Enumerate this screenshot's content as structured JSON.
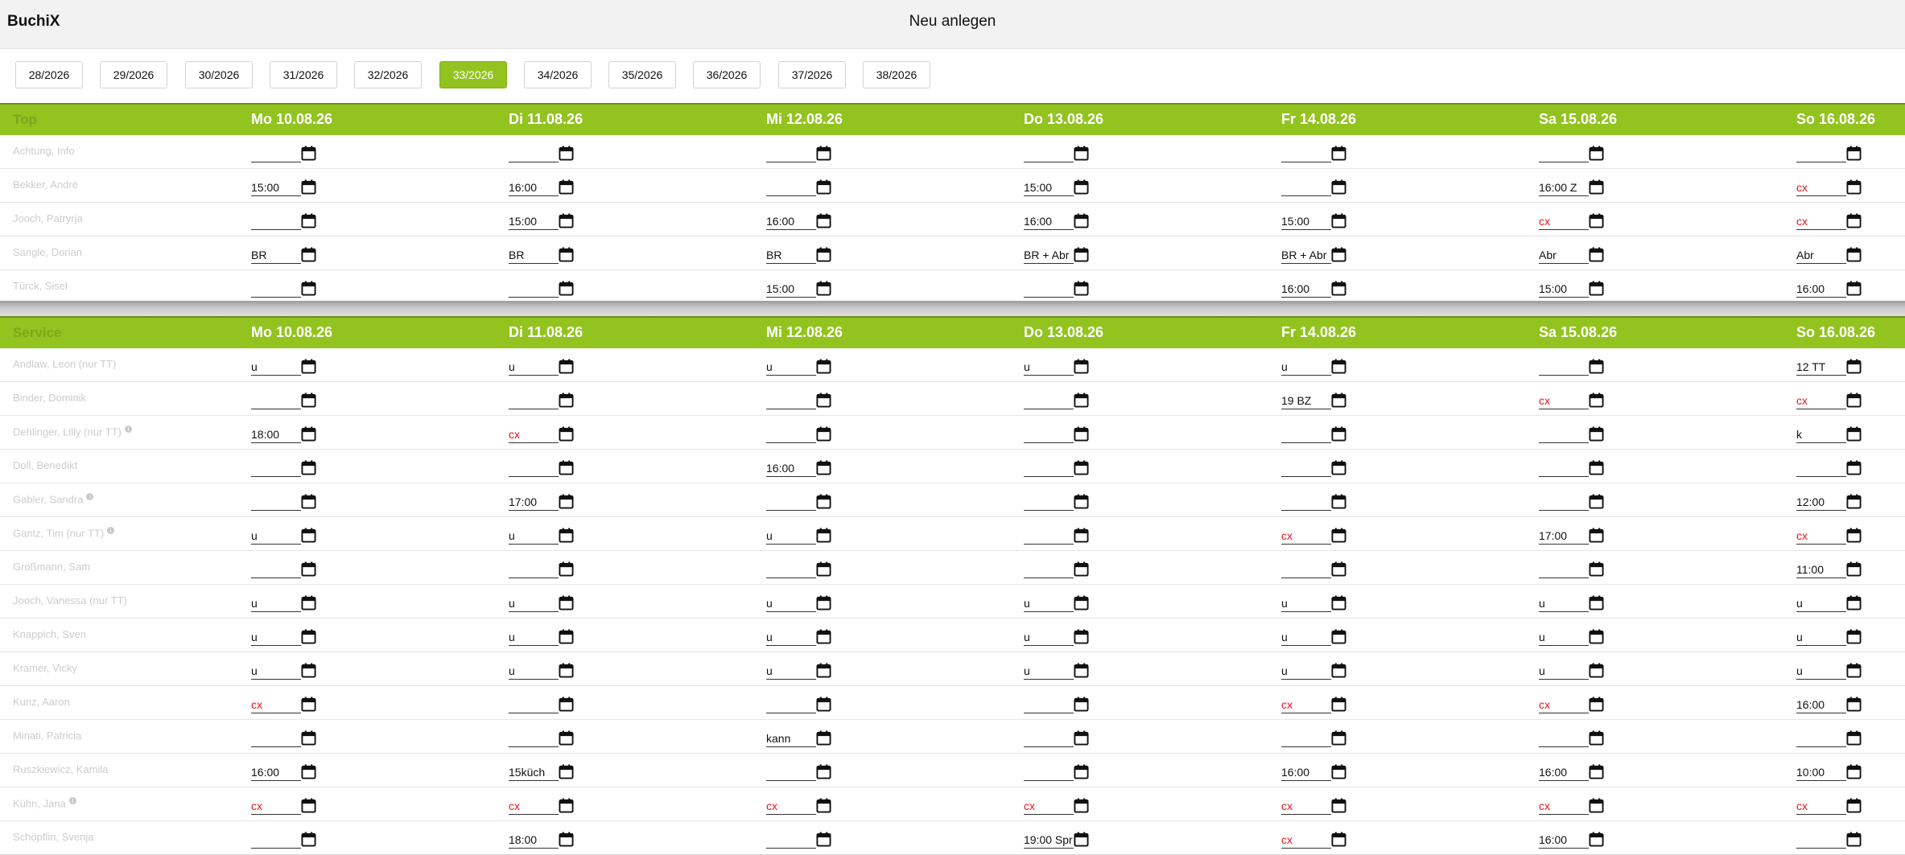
{
  "app": {
    "title": "BuchiX",
    "action": "Neu anlegen"
  },
  "weeks": [
    {
      "label": "28/2026",
      "active": false
    },
    {
      "label": "29/2026",
      "active": false
    },
    {
      "label": "30/2026",
      "active": false
    },
    {
      "label": "31/2026",
      "active": false
    },
    {
      "label": "32/2026",
      "active": false
    },
    {
      "label": "33/2026",
      "active": true
    },
    {
      "label": "34/2026",
      "active": false
    },
    {
      "label": "35/2026",
      "active": false
    },
    {
      "label": "36/2026",
      "active": false
    },
    {
      "label": "37/2026",
      "active": false
    },
    {
      "label": "38/2026",
      "active": false
    }
  ],
  "days": [
    "Mo 10.08.26",
    "Di 11.08.26",
    "Mi 12.08.26",
    "Do 13.08.26",
    "Fr 14.08.26",
    "Sa 15.08.26",
    "So 16.08.26"
  ],
  "colors": {
    "accent": "#92c31f",
    "cancel_text": "#e8141c",
    "name_text": "#cdcdcd"
  },
  "sections": [
    {
      "name": "Top",
      "rows": [
        {
          "name": "Achtung, Info",
          "info": false,
          "cells": [
            "",
            "",
            "",
            "",
            "",
            "",
            ""
          ]
        },
        {
          "name": "Bekker, André",
          "info": false,
          "cells": [
            "15:00",
            "16:00",
            "",
            "15:00",
            "",
            "16:00 Z",
            "cx"
          ]
        },
        {
          "name": "Jooch, Patryrja",
          "info": false,
          "cells": [
            "",
            "15:00",
            "16:00",
            "16:00",
            "15:00",
            "cx",
            "cx"
          ]
        },
        {
          "name": "Sangle, Dorian",
          "info": false,
          "cells": [
            "BR",
            "BR",
            "BR",
            "BR + Abr",
            "BR + Abr",
            "Abr",
            "Abr"
          ]
        },
        {
          "name": "Türck, Sisel",
          "info": false,
          "cells": [
            "",
            "",
            "15:00",
            "",
            "16:00",
            "15:00",
            "16:00"
          ]
        }
      ]
    },
    {
      "name": "Service",
      "rows": [
        {
          "name": "Andlaw, Leon (nur TT)",
          "info": false,
          "cells": [
            "u",
            "u",
            "u",
            "u",
            "u",
            "",
            "12 TT"
          ]
        },
        {
          "name": "Binder, Dominik",
          "info": false,
          "cells": [
            "",
            "",
            "",
            "",
            "19 BZ",
            "cx",
            "cx"
          ]
        },
        {
          "name": "Dehlinger, Lilly (nur TT)",
          "info": true,
          "cells": [
            "18:00",
            "cx",
            "",
            "",
            "",
            "",
            "k"
          ]
        },
        {
          "name": "Doll, Benedikt",
          "info": false,
          "cells": [
            "",
            "",
            "16:00",
            "",
            "",
            "",
            ""
          ]
        },
        {
          "name": "Gabler, Sandra",
          "info": true,
          "cells": [
            "",
            "17:00",
            "",
            "",
            "",
            "",
            "12:00"
          ]
        },
        {
          "name": "Gantz, Tim (nur TT)",
          "info": true,
          "cells": [
            "u",
            "u",
            "u",
            "",
            "cx",
            "17:00",
            "cx"
          ]
        },
        {
          "name": "Großmann, Sam",
          "info": false,
          "cells": [
            "",
            "",
            "",
            "",
            "",
            "",
            "11:00"
          ]
        },
        {
          "name": "Jooch, Vanessa (nur TT)",
          "info": false,
          "cells": [
            "u",
            "u",
            "u",
            "u",
            "u",
            "u",
            "u"
          ]
        },
        {
          "name": "Knappich, Sven",
          "info": false,
          "cells": [
            "u",
            "u",
            "u",
            "u",
            "u",
            "u",
            "u"
          ]
        },
        {
          "name": "Kramer, Vicky",
          "info": false,
          "cells": [
            "u",
            "u",
            "u",
            "u",
            "u",
            "u",
            "u"
          ]
        },
        {
          "name": "Kunz, Aaron",
          "info": false,
          "cells": [
            "cx",
            "",
            "",
            "",
            "cx",
            "cx",
            "16:00"
          ]
        },
        {
          "name": "Minati, Patricia",
          "info": false,
          "cells": [
            "",
            "",
            "kann",
            "",
            "",
            "",
            ""
          ]
        },
        {
          "name": "Ruszkiewicz, Kamila",
          "info": false,
          "cells": [
            "16:00",
            "15küch",
            "",
            "",
            "16:00",
            "16:00",
            "10:00"
          ]
        },
        {
          "name": "Kühn, Jana",
          "info": true,
          "cells": [
            "cx",
            "cx",
            "cx",
            "cx",
            "cx",
            "cx",
            "cx"
          ]
        },
        {
          "name": "Schöpflin, Svenja",
          "info": false,
          "cells": [
            "",
            "18:00",
            "",
            "19:00 Spr",
            "cx",
            "16:00",
            ""
          ]
        }
      ]
    }
  ]
}
